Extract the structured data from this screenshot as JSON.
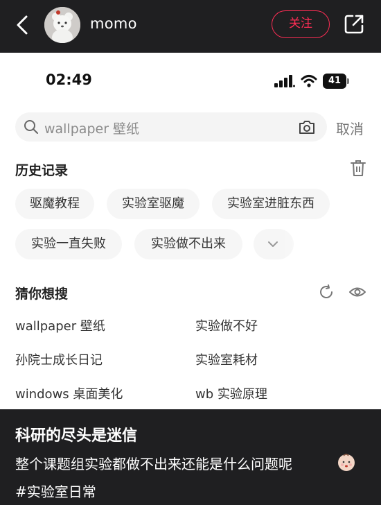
{
  "header": {
    "username": "momo",
    "follow_label": "关注",
    "icons": {
      "back": "chevron-left-icon",
      "share": "share-out-icon",
      "avatar": "bear-avatar"
    }
  },
  "screenshot": {
    "status": {
      "time": "02:49",
      "battery": "41"
    },
    "search": {
      "query": "wallpaper 壁纸",
      "cancel_label": "取消"
    },
    "history": {
      "title": "历史记录",
      "items": [
        "驱魔教程",
        "实验室驱魔",
        "实验室进脏东西",
        "实验一直失败",
        "实验做不出来"
      ]
    },
    "guess": {
      "title": "猜你想搜",
      "items": [
        "wallpaper 壁纸",
        "实验做不好",
        "孙院士成长日记",
        "实验室耗材",
        "windows 桌面美化",
        "wb 实验原理"
      ]
    }
  },
  "caption": {
    "title": "科研的尽头是迷信",
    "body": "整个课题组实验都做不出来还能是什么问题呢",
    "hashtag": "#实验室日常"
  },
  "colors": {
    "accent": "#ff2d55",
    "dark_bg": "#1f1f21",
    "chip_bg": "#f6f6f6"
  }
}
